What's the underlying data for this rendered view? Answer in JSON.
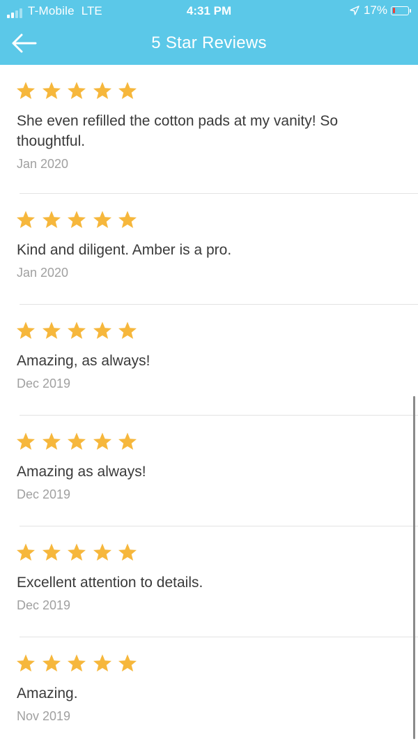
{
  "status_bar": {
    "carrier": "T-Mobile",
    "network": "LTE",
    "time": "4:31 PM",
    "battery_percent": "17%",
    "battery_level": 0.17,
    "battery_color": "#e8423b",
    "signal_bars_active": 2
  },
  "nav": {
    "title": "5 Star Reviews",
    "back_icon": "arrow-left-icon",
    "background_color": "#5bc8e8"
  },
  "star_color": "#f6b73c",
  "reviews": [
    {
      "rating": 5,
      "text": "She even refilled the cotton pads at my vanity! So thoughtful.",
      "date": "Jan 2020"
    },
    {
      "rating": 5,
      "text": "Kind and diligent. Amber is a pro.",
      "date": "Jan 2020"
    },
    {
      "rating": 5,
      "text": "Amazing, as always!",
      "date": "Dec 2019"
    },
    {
      "rating": 5,
      "text": "Amazing as always!",
      "date": "Dec 2019"
    },
    {
      "rating": 5,
      "text": "Excellent attention to details.",
      "date": "Dec 2019"
    },
    {
      "rating": 5,
      "text": "Amazing.",
      "date": "Nov 2019"
    }
  ]
}
